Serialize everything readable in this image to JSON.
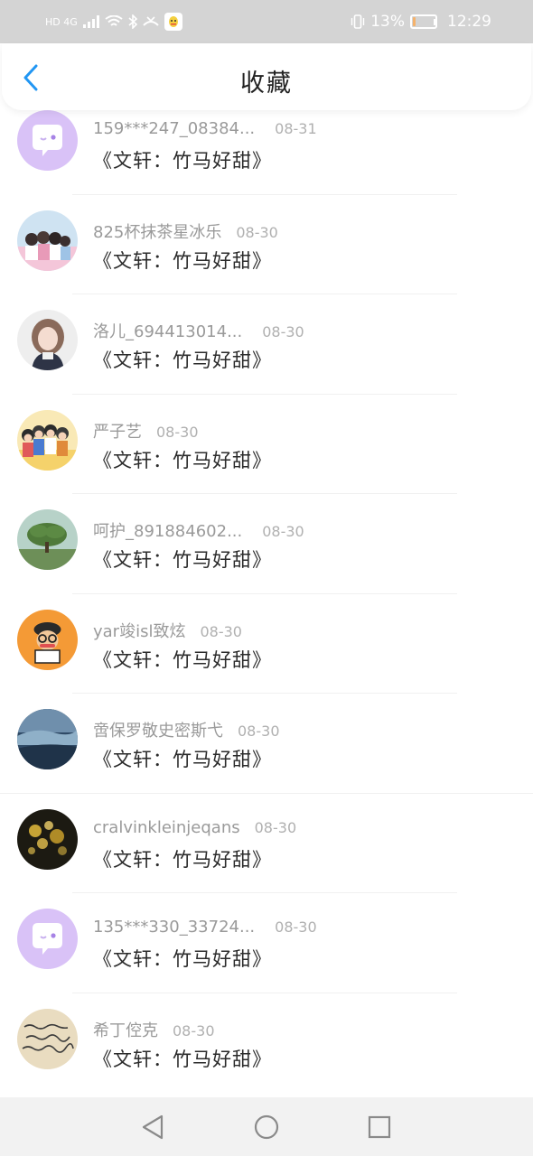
{
  "status_bar": {
    "network": "HD 4G",
    "battery": "13%",
    "battery_level": 0.13,
    "time": "12:29"
  },
  "header": {
    "title": "收藏"
  },
  "items": [
    {
      "name": "159***247_08384...",
      "date": "08-31",
      "message": "《文轩：竹马好甜》"
    },
    {
      "name": "825杯抹茶星冰乐",
      "date": "08-30",
      "message": "《文轩：竹马好甜》"
    },
    {
      "name": "洛儿_694413014...",
      "date": "08-30",
      "message": "《文轩：竹马好甜》"
    },
    {
      "name": "严子艺",
      "date": "08-30",
      "message": "《文轩：竹马好甜》"
    },
    {
      "name": "呵护_891884602...",
      "date": "08-30",
      "message": "《文轩：竹马好甜》"
    },
    {
      "name": "yar竣isl致炫",
      "date": "08-30",
      "message": "《文轩：竹马好甜》"
    },
    {
      "name": "啻保罗敬史密斯弋",
      "date": "08-30",
      "message": "《文轩：竹马好甜》"
    },
    {
      "name": "cralvinkleinjeqans",
      "date": "08-30",
      "message": "《文轩：竹马好甜》"
    },
    {
      "name": "135***330_33724...",
      "date": "08-30",
      "message": "《文轩：竹马好甜》"
    },
    {
      "name": "希丁倥克",
      "date": "08-30",
      "message": "《文轩：竹马好甜》"
    }
  ],
  "colors": {
    "accent": "#2196f3",
    "status_bar_bg": "#d4d4d4",
    "nav_bar_bg": "#f2f2f2",
    "default_avatar": "#d9c2f7"
  }
}
